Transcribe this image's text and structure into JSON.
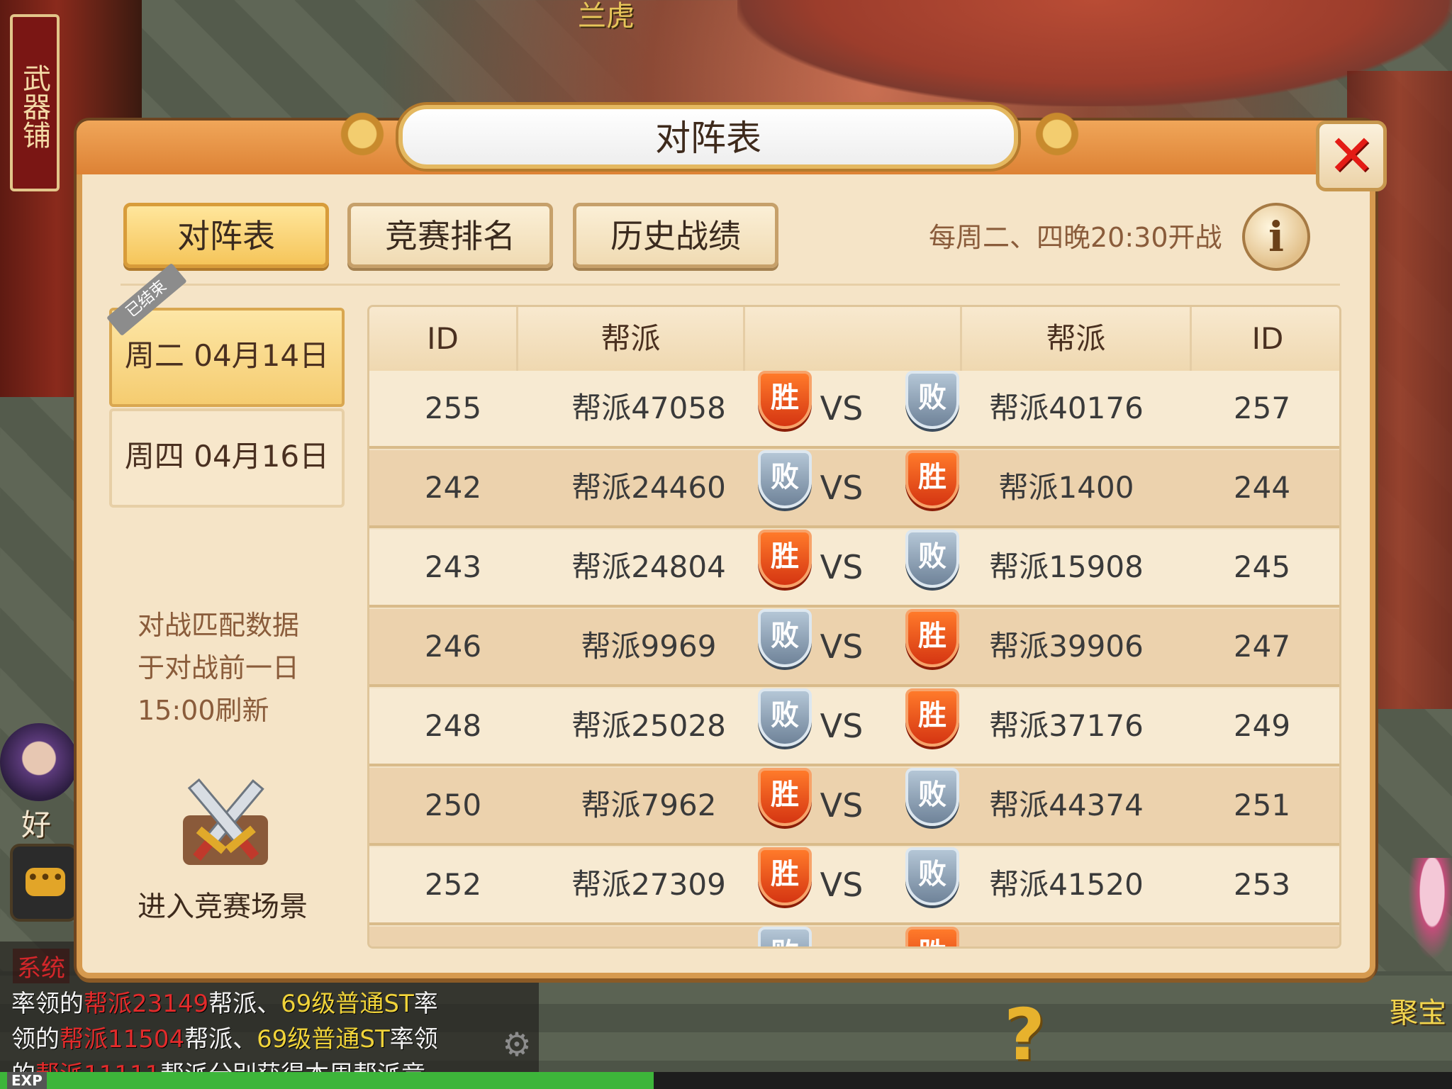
{
  "background": {
    "top_name": "兰虎",
    "banner_text": "武器铺",
    "friend_label": "好友",
    "treasure_label": "聚宝",
    "chat": {
      "tag": "系统",
      "lines": [
        {
          "pre": "率领的",
          "red": "帮派23149",
          "mid": "帮派、",
          "yel": "69级普通ST",
          "post": "率"
        },
        {
          "pre": "领的",
          "red": "帮派11504",
          "mid": "帮派、",
          "yel": "69级普通ST",
          "post": "率领"
        },
        {
          "pre": "的",
          "red": "帮派11111",
          "mid": "帮派分别获得本周帮派竞",
          "yel": "",
          "post": ""
        }
      ]
    },
    "exp_label": "EXP",
    "exp_progress": 0.45,
    "help_icon": "question-icon"
  },
  "dialog": {
    "title": "对阵表",
    "close_icon": "close-icon",
    "tabs": [
      {
        "label": "对阵表",
        "active": true
      },
      {
        "label": "竞赛排名",
        "active": false
      },
      {
        "label": "历史战绩",
        "active": false
      }
    ],
    "schedule": "每周二、四晚20:30开战",
    "info_icon": "info-icon",
    "dates": [
      {
        "label": "周二  04月14日",
        "status": "已结束",
        "active": true
      },
      {
        "label": "周四  04月16日",
        "active": false
      }
    ],
    "note_lines": [
      "对战匹配数据",
      "于对战前一日",
      "15:00刷新"
    ],
    "enter_label": "进入竞赛场景"
  },
  "table": {
    "headers": [
      "ID",
      "帮派",
      "",
      "帮派",
      "ID"
    ],
    "vs_label": "VS",
    "win_label": "胜",
    "lose_label": "败",
    "rows": [
      {
        "id1": "255",
        "guild1": "帮派47058",
        "r1": "胜",
        "r2": "败",
        "guild2": "帮派40176",
        "id2": "257"
      },
      {
        "id1": "242",
        "guild1": "帮派24460",
        "r1": "败",
        "r2": "胜",
        "guild2": "帮派1400",
        "id2": "244"
      },
      {
        "id1": "243",
        "guild1": "帮派24804",
        "r1": "胜",
        "r2": "败",
        "guild2": "帮派15908",
        "id2": "245"
      },
      {
        "id1": "246",
        "guild1": "帮派9969",
        "r1": "败",
        "r2": "胜",
        "guild2": "帮派39906",
        "id2": "247"
      },
      {
        "id1": "248",
        "guild1": "帮派25028",
        "r1": "败",
        "r2": "胜",
        "guild2": "帮派37176",
        "id2": "249"
      },
      {
        "id1": "250",
        "guild1": "帮派7962",
        "r1": "胜",
        "r2": "败",
        "guild2": "帮派44374",
        "id2": "251"
      },
      {
        "id1": "252",
        "guild1": "帮派27309",
        "r1": "胜",
        "r2": "败",
        "guild2": "帮派41520",
        "id2": "253"
      },
      {
        "id1": "",
        "guild1": "",
        "r1": "败",
        "r2": "胜",
        "guild2": "",
        "id2": ""
      }
    ]
  },
  "colors": {
    "win": "#e2431a",
    "lose": "#7f93a8",
    "accent": "#f5c55a"
  }
}
